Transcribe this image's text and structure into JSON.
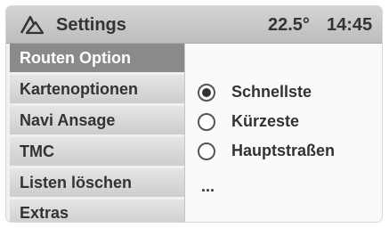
{
  "header": {
    "icon": "navigation-arrow-icon",
    "title": "Settings",
    "temperature": "22.5°",
    "time": "14:45"
  },
  "menu": {
    "items": [
      {
        "label": "Routen Option",
        "selected": true
      },
      {
        "label": "Kartenoptionen",
        "selected": false
      },
      {
        "label": "Navi Ansage",
        "selected": false
      },
      {
        "label": "TMC",
        "selected": false
      },
      {
        "label": "Listen löschen",
        "selected": false
      },
      {
        "label": "Extras",
        "selected": false
      }
    ]
  },
  "options": {
    "items": [
      {
        "label": "Schnellste",
        "checked": true
      },
      {
        "label": "Kürzeste",
        "checked": false
      },
      {
        "label": "Hauptstraßen",
        "checked": false
      }
    ],
    "more": "..."
  },
  "colors": {
    "selected_bg": "#8a8a8a",
    "header_bg": "#c8c8c8"
  }
}
